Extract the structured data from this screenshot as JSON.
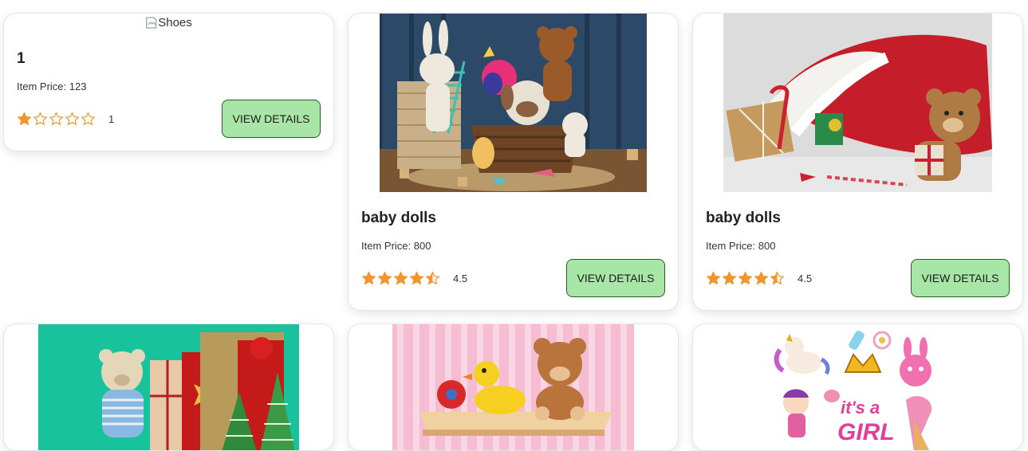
{
  "colors": {
    "button_bg": "#a8e6a8",
    "button_border": "#2a5a2a",
    "star_fill": "#f0962c"
  },
  "cards": [
    {
      "title": "1",
      "price": "Item Price: 123",
      "rating": "1",
      "stars": 1,
      "button": "VIEW DETAILS",
      "image_alt": "Shoes",
      "image": "broken-image"
    },
    {
      "title": "baby dolls",
      "price": "Item Price: 800",
      "rating": "4.5",
      "stars": 4.5,
      "button": "VIEW DETAILS",
      "image": "stuffed-toys-basket-photo"
    },
    {
      "title": "baby dolls",
      "price": "Item Price: 800",
      "rating": "4.5",
      "stars": 4.5,
      "button": "VIEW DETAILS",
      "image": "santa-sack-teddy-photo"
    },
    {
      "image": "teddy-gifts-trees-photo"
    },
    {
      "image": "duck-teddy-shelf-photo"
    },
    {
      "image": "its-a-girl-stickers"
    }
  ]
}
